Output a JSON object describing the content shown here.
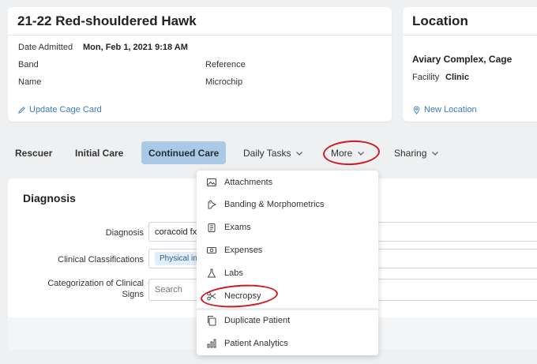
{
  "patient_card": {
    "title": "21-22 Red-shouldered Hawk",
    "date_admitted_label": "Date Admitted",
    "date_admitted_value": "Mon, Feb 1, 2021 9:18 AM",
    "band_label": "Band",
    "reference_label": "Reference",
    "name_label": "Name",
    "microchip_label": "Microchip",
    "update_link": "Update Cage Card"
  },
  "location_card": {
    "title": "Location",
    "location_value": "Aviary Complex, Cage",
    "facility_label": "Facility",
    "facility_value": "Clinic",
    "new_location_link": "New Location"
  },
  "tabs": {
    "rescuer": "Rescuer",
    "initial_care": "Initial Care",
    "continued_care": "Continued Care",
    "daily_tasks": "Daily Tasks",
    "more": "More",
    "sharing": "Sharing"
  },
  "diagnosis": {
    "title": "Diagnosis",
    "diagnosis_label": "Diagnosis",
    "diagnosis_value": "coracoid fx",
    "clinical_classifications_label": "Clinical Classifications",
    "clinical_chip": "Physical in",
    "categorization_label": "Categorization of Clinical Signs",
    "search_placeholder": "Search"
  },
  "more_menu": {
    "items": [
      "Attachments",
      "Banding & Morphometrics",
      "Exams",
      "Expenses",
      "Labs",
      "Necropsy",
      "Duplicate Patient",
      "Patient Analytics"
    ]
  },
  "colors": {
    "active_tab": "#a9c9e4",
    "link": "#3b7bbf",
    "annotation": "#d4181f"
  }
}
